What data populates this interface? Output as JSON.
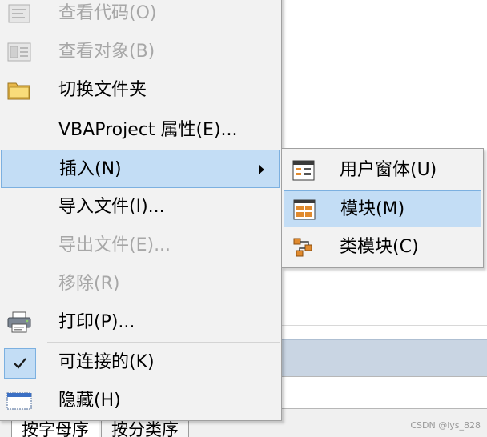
{
  "background": {
    "tabs": [
      "按字母序",
      "按分类序"
    ],
    "watermark": "CSDN @lys_828"
  },
  "menu": {
    "items": [
      {
        "label": "查看代码(O)",
        "icon": "code-view-icon",
        "enabled": false
      },
      {
        "label": "查看对象(B)",
        "icon": "object-view-icon",
        "enabled": false
      },
      {
        "label": "切换文件夹",
        "icon": "folder-icon",
        "enabled": true
      },
      {
        "label": "VBAProject 属性(E)...",
        "icon": null,
        "enabled": true
      },
      {
        "label": "插入(N)",
        "icon": null,
        "enabled": true,
        "submenu": true,
        "highlighted": true
      },
      {
        "label": "导入文件(I)...",
        "icon": null,
        "enabled": true
      },
      {
        "label": "导出文件(E)...",
        "icon": null,
        "enabled": false
      },
      {
        "label": "移除(R)",
        "icon": null,
        "enabled": false
      },
      {
        "label": "打印(P)...",
        "icon": "printer-icon",
        "enabled": true
      },
      {
        "label": "可连接的(K)",
        "icon": "check-icon",
        "enabled": true,
        "checked": true
      },
      {
        "label": "隐藏(H)",
        "icon": "hide-window-icon",
        "enabled": true
      }
    ]
  },
  "submenu": {
    "items": [
      {
        "label": "用户窗体(U)",
        "icon": "userform-icon"
      },
      {
        "label": "模块(M)",
        "icon": "module-icon",
        "highlighted": true
      },
      {
        "label": "类模块(C)",
        "icon": "class-module-icon"
      }
    ]
  },
  "colors": {
    "menu_bg": "#f2f2f2",
    "highlight_bg": "#c3ddf5",
    "highlight_border": "#7cb0e0",
    "disabled_text": "#a7a7a7",
    "background_band": "#c9d5e3"
  }
}
